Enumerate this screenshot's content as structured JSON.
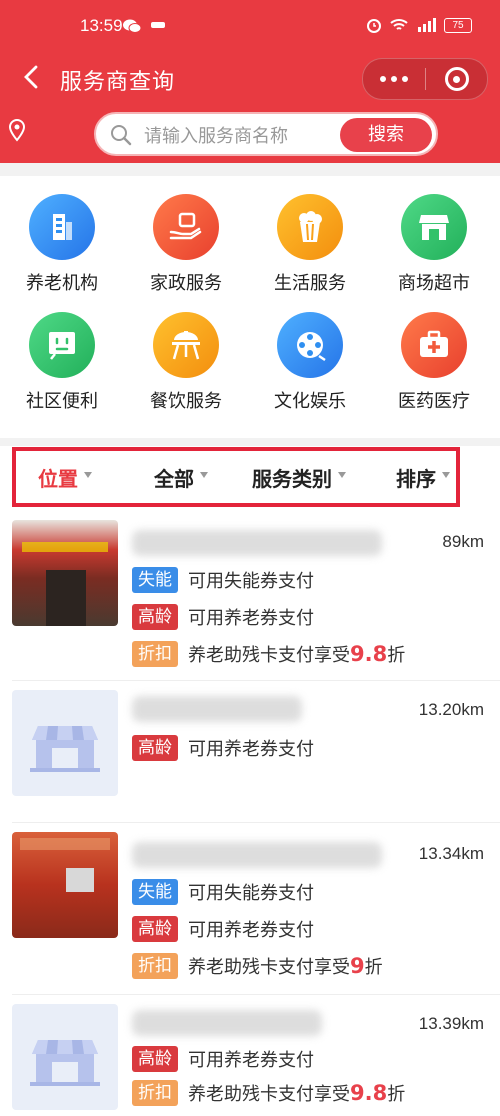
{
  "status_bar": {
    "time": "13:59",
    "battery": "75"
  },
  "nav": {
    "title": "服务商查询"
  },
  "search": {
    "placeholder": "请输入服务商名称",
    "button": "搜索"
  },
  "categories": [
    {
      "label": "养老机构",
      "color": "#2f8ff0"
    },
    {
      "label": "家政服务",
      "color": "#f25a3c"
    },
    {
      "label": "生活服务",
      "color": "#f9a21b"
    },
    {
      "label": "商场超市",
      "color": "#32c26a"
    },
    {
      "label": "社区便利",
      "color": "#32c26a"
    },
    {
      "label": "餐饮服务",
      "color": "#f9a21b"
    },
    {
      "label": "文化娱乐",
      "color": "#2f8ff0"
    },
    {
      "label": "医药医疗",
      "color": "#f25a3c"
    }
  ],
  "filters": {
    "location": "位置",
    "all": "全部",
    "type": "服务类别",
    "sort": "排序"
  },
  "items": [
    {
      "distance": "89km",
      "tags": [
        {
          "label": "失能",
          "text": "可用失能券支付",
          "color": "blue"
        },
        {
          "label": "高龄",
          "text": "可用养老券支付",
          "color": "red"
        },
        {
          "label": "折扣",
          "text": "养老助残卡支付享受",
          "discount": "9.8",
          "suffix": "折",
          "color": "orange"
        }
      ]
    },
    {
      "distance": "13.20km",
      "tags": [
        {
          "label": "高龄",
          "text": "可用养老券支付",
          "color": "red"
        }
      ]
    },
    {
      "distance": "13.34km",
      "tags": [
        {
          "label": "失能",
          "text": "可用失能券支付",
          "color": "blue"
        },
        {
          "label": "高龄",
          "text": "可用养老券支付",
          "color": "red"
        },
        {
          "label": "折扣",
          "text": "养老助残卡支付享受",
          "discount": "9",
          "suffix": "折",
          "color": "orange"
        }
      ]
    },
    {
      "distance": "13.39km",
      "tags": [
        {
          "label": "高龄",
          "text": "可用养老券支付",
          "color": "red"
        },
        {
          "label": "折扣",
          "text": "养老助残卡支付享受",
          "discount": "9.8",
          "suffix": "折",
          "color": "orange"
        }
      ]
    }
  ]
}
